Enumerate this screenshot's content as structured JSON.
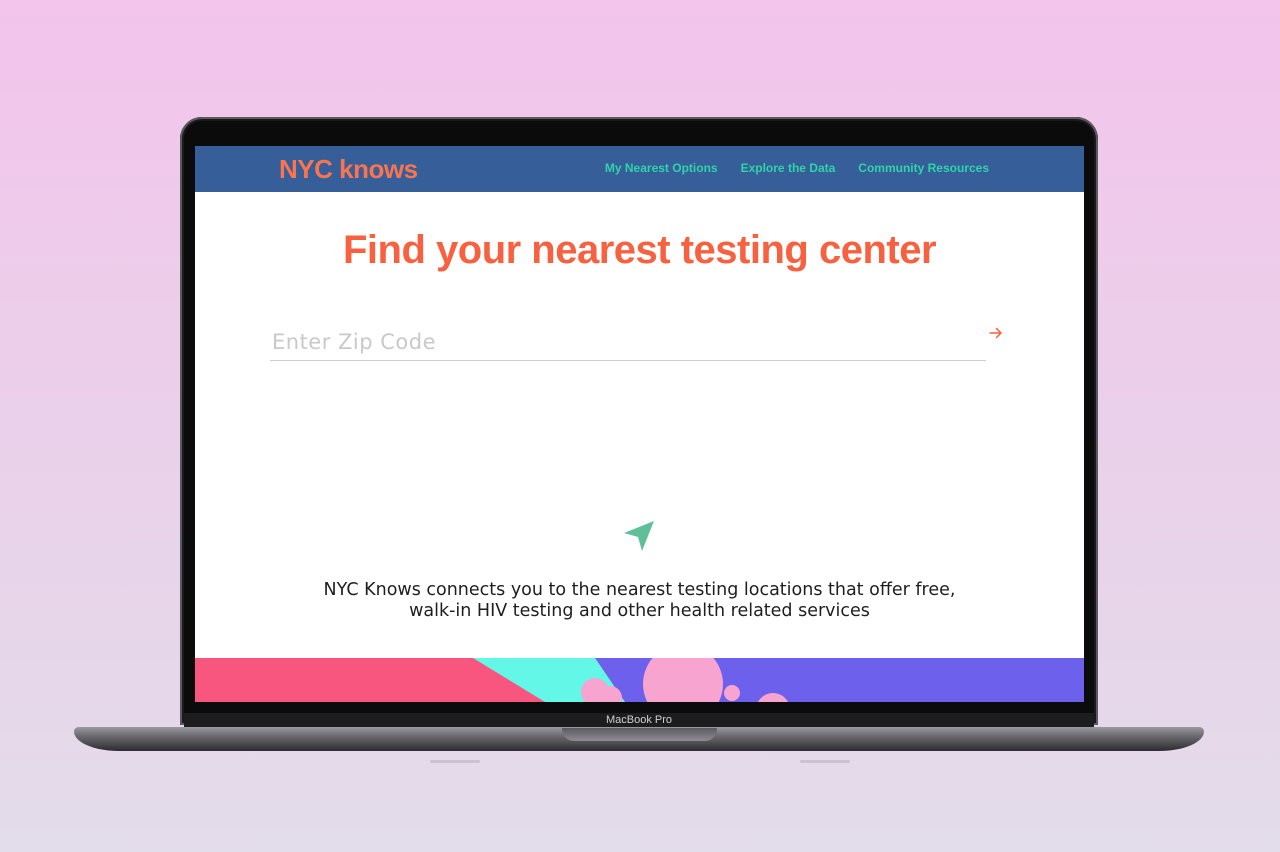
{
  "device": {
    "label": "MacBook Pro"
  },
  "site": {
    "logo": "NYC knows",
    "nav": [
      {
        "label": "My Nearest Options"
      },
      {
        "label": "Explore the Data"
      },
      {
        "label": "Community Resources"
      }
    ],
    "headline": "Find your nearest testing center",
    "zip_input": {
      "placeholder": "Enter Zip Code",
      "value": ""
    },
    "tagline_line1": "NYC Knows connects you to the nearest testing locations that offer free,",
    "tagline_line2": "walk-in HIV testing and other health related services"
  },
  "icons": {
    "submit": "arrow-right-icon",
    "location": "location-arrow-icon"
  },
  "colors": {
    "nav_bg": "#365e99",
    "logo": "#f9744f",
    "nav_link": "#2fd4a9",
    "headline": "#f8613f",
    "location_icon": "#5fbf98",
    "banner_purple": "#6d60ec",
    "banner_pink": "#f8557f",
    "banner_teal": "#62f7e7",
    "banner_bubble": "#f7a5d0"
  }
}
